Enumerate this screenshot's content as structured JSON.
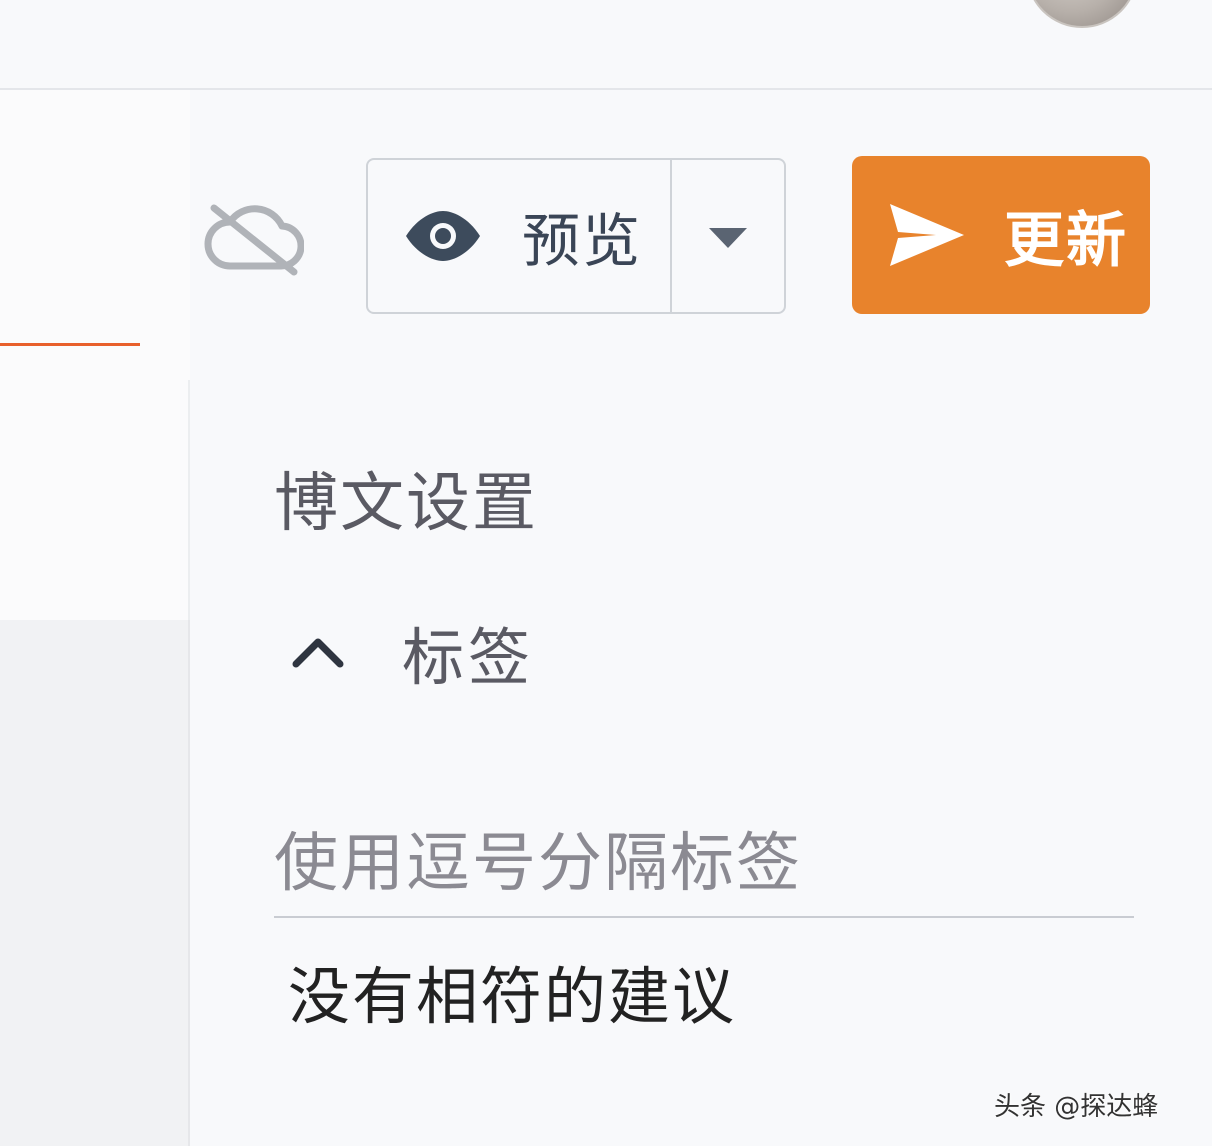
{
  "header": {
    "avatar": "user-avatar"
  },
  "toolbar": {
    "cloud_icon": "cloud-off-icon",
    "preview_label": "预览",
    "preview_icon": "eye-icon",
    "preview_dropdown_icon": "caret-down-icon",
    "update_label": "更新",
    "update_icon": "send-icon",
    "update_color": "#e8832c"
  },
  "settings": {
    "title": "博文设置",
    "tags": {
      "label": "标签",
      "expand_icon": "chevron-up-icon",
      "input_placeholder": "使用逗号分隔标签",
      "input_value": "",
      "suggestion_text": "没有相符的建议"
    }
  },
  "watermark": {
    "text": "头条 @探达蜂"
  },
  "colors": {
    "accent": "#e8832c",
    "left_accent_line": "#e8602c",
    "text_primary": "#222222",
    "text_secondary": "#5a5a63"
  }
}
